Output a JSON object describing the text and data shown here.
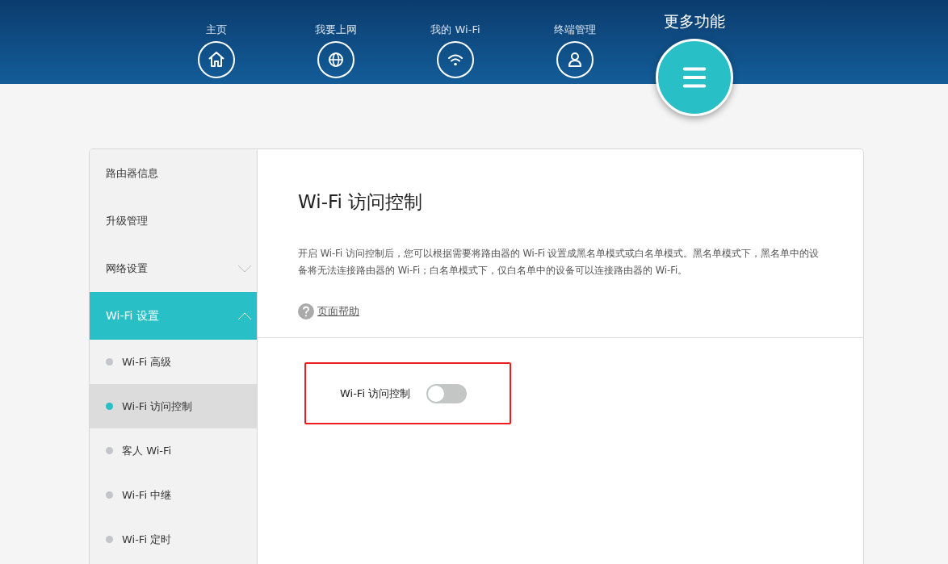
{
  "nav": [
    {
      "label": "主页",
      "kind": "home",
      "selected": false
    },
    {
      "label": "我要上网",
      "kind": "globe",
      "selected": false
    },
    {
      "label": "我的 Wi-Fi",
      "kind": "wifi",
      "selected": false
    },
    {
      "label": "终端管理",
      "kind": "user",
      "selected": false
    },
    {
      "label": "更多功能",
      "kind": "menu",
      "selected": true
    }
  ],
  "sidebar": {
    "items": [
      {
        "label": "路由器信息",
        "selected": false
      },
      {
        "label": "升级管理",
        "selected": false
      },
      {
        "label": "网络设置",
        "selected": false,
        "expanded": false
      },
      {
        "label": "Wi-Fi 设置",
        "selected": true,
        "expanded": true,
        "children": [
          {
            "label": "Wi-Fi 高级",
            "selected": false
          },
          {
            "label": "Wi-Fi 访问控制",
            "selected": true
          },
          {
            "label": "客人 Wi-Fi",
            "selected": false
          },
          {
            "label": "Wi-Fi 中继",
            "selected": false
          },
          {
            "label": "Wi-Fi 定时",
            "selected": false
          }
        ]
      }
    ]
  },
  "content": {
    "title": "Wi-Fi 访问控制",
    "description": "开启 Wi-Fi 访问控制后，您可以根据需要将路由器的 Wi-Fi 设置成黑名单模式或白名单模式。黑名单模式下，黑名单中的设备将无法连接路由器的 Wi-Fi；白名单模式下，仅白名单中的设备可以连接路由器的 Wi-Fi。",
    "help_link": "页面帮助",
    "toggle": {
      "label": "Wi-Fi 访问控制",
      "on": false,
      "highlighted": true
    }
  }
}
